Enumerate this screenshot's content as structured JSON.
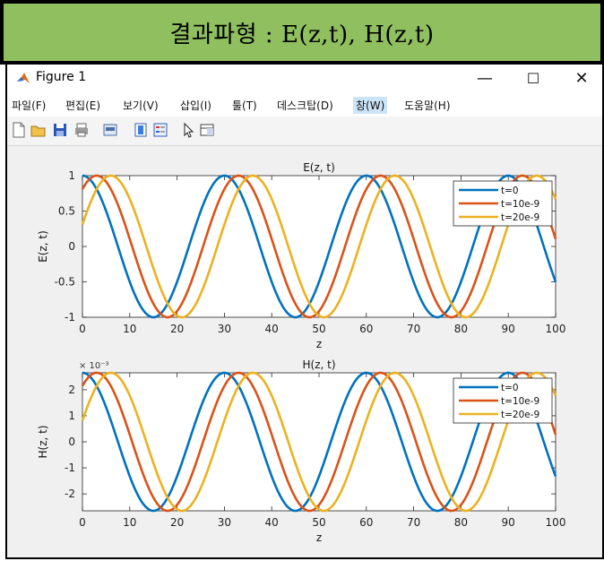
{
  "banner": {
    "text": "결과파형 : E(z,t),  H(z,t)"
  },
  "window": {
    "title": "Figure 1",
    "buttons": {
      "minimize": "—",
      "maximize": "☐",
      "close": "✕"
    }
  },
  "menu": [
    {
      "label": "파일(F)"
    },
    {
      "label": "편집(E)"
    },
    {
      "label": "보기(V)"
    },
    {
      "label": "삽입(I)"
    },
    {
      "label": "툴(T)"
    },
    {
      "label": "데스크탑(D)"
    },
    {
      "label": "창(W)",
      "active": true
    },
    {
      "label": "도움말(H)"
    }
  ],
  "toolbar": [
    "new-figure-icon",
    "open-icon",
    "save-icon",
    "print-icon",
    "link-plot-icon",
    "insert-colorbar-icon",
    "insert-legend-icon",
    "edit-plot-icon",
    "property-inspector-icon"
  ],
  "colors": {
    "t0": "#0072bd",
    "t10": "#d95319",
    "t20": "#edb120"
  },
  "chart_data": [
    {
      "type": "line",
      "title": "E(z, t)",
      "xlabel": "z",
      "ylabel": "E(z, t)",
      "xlim": [
        0,
        100
      ],
      "ylim": [
        -1,
        1
      ],
      "xticks": [
        "0",
        "10",
        "20",
        "30",
        "40",
        "50",
        "60",
        "70",
        "80",
        "90",
        "100"
      ],
      "yticks": [
        "1",
        "0.5",
        "0",
        "-0.5",
        "-1"
      ],
      "exponent": "",
      "legend_position": "top-right",
      "series": [
        {
          "name": "t=0",
          "amplitude": 1,
          "wavelength_z": 30,
          "peak_z": 0
        },
        {
          "name": "t=10e-9",
          "amplitude": 1,
          "wavelength_z": 30,
          "peak_z": 3
        },
        {
          "name": "t=20e-9",
          "amplitude": 1,
          "wavelength_z": 30,
          "peak_z": 6
        }
      ]
    },
    {
      "type": "line",
      "title": "H(z, t)",
      "xlabel": "z",
      "ylabel": "H(z, t)",
      "xlim": [
        0,
        100
      ],
      "ylim": [
        -0.00265,
        0.00265
      ],
      "xticks": [
        "0",
        "10",
        "20",
        "30",
        "40",
        "50",
        "60",
        "70",
        "80",
        "90",
        "100"
      ],
      "yticks": [
        "2",
        "1",
        "0",
        "-1",
        "-2"
      ],
      "exponent": "× 10⁻³",
      "legend_position": "top-right",
      "series": [
        {
          "name": "t=0",
          "amplitude": 0.00265,
          "wavelength_z": 30,
          "peak_z": 0
        },
        {
          "name": "t=10e-9",
          "amplitude": 0.00265,
          "wavelength_z": 30,
          "peak_z": 3
        },
        {
          "name": "t=20e-9",
          "amplitude": 0.00265,
          "wavelength_z": 30,
          "peak_z": 6
        }
      ]
    }
  ]
}
